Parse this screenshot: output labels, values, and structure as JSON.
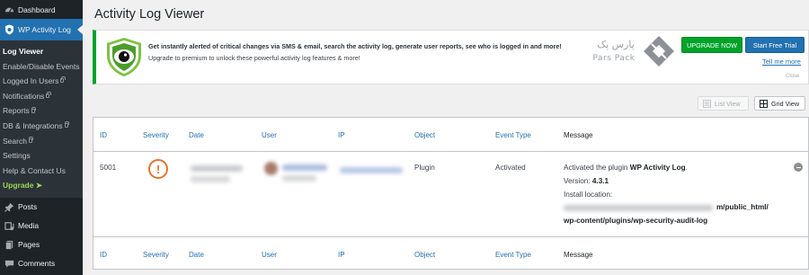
{
  "sidebar": {
    "dashboard": "Dashboard",
    "plugin_menu": "WP Activity Log",
    "submenu": [
      "Log Viewer",
      "Enable/Disable Events",
      "Logged In Users",
      "Notifications",
      "Reports",
      "DB & Integrations",
      "Search",
      "Settings",
      "Help & Contact Us",
      "Upgrade ➤"
    ],
    "posts": "Posts",
    "media": "Media",
    "pages": "Pages",
    "comments": "Comments"
  },
  "page": {
    "title": "Activity Log Viewer"
  },
  "banner": {
    "headline": "Get instantly alerted of critical changes via SMS & email, search the activity log, generate user reports, see who is logged in and more!",
    "subline": "Upgrade to premium to unlock these powerful activity log features & more!",
    "logo_text_fa": "پارس پک",
    "logo_text_en": "Pars Pack",
    "upgrade_button": "UPGRADE NOW",
    "trial_button": "Start Free Trial",
    "tell_more": "Tell me more",
    "close": "Close"
  },
  "view": {
    "list": "List View",
    "grid": "Grid View"
  },
  "table": {
    "headers": [
      "ID",
      "Severity",
      "Date",
      "User",
      "IP",
      "Object",
      "Event Type",
      "Message"
    ],
    "row": {
      "id": "5001",
      "severity_icon": "!",
      "object": "Plugin",
      "event_type": "Activated",
      "message_prefix": "Activated the plugin ",
      "message_plugin": "WP Activity Log",
      "message_suffix": ".",
      "version_label": "Version: ",
      "version": "4.3.1",
      "install_label": "Install location:",
      "path_line1": "m/public_html/",
      "path_line2": "wp-content/plugins/wp-security-audit-log"
    }
  },
  "colors": {
    "sidebar_bg": "#1d2327",
    "accent_blue": "#2271b1",
    "upgrade_green": "#00a32a",
    "severity_orange": "#e8742b"
  }
}
